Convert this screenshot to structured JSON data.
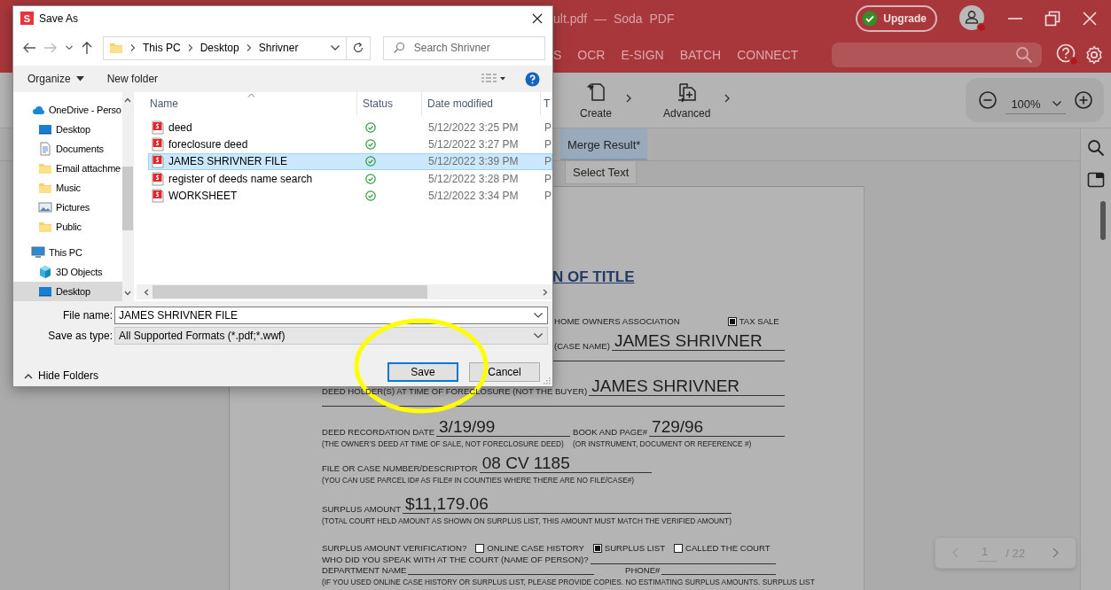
{
  "app": {
    "title": "ult.pdf — Soda PDF",
    "upgrade": "Upgrade",
    "nav": [
      {
        "label": "S"
      },
      {
        "label": "OCR"
      },
      {
        "label": "E-SIGN"
      },
      {
        "label": "BATCH"
      },
      {
        "label": "CONNECT"
      }
    ],
    "tools": [
      {
        "label": "Create",
        "kind": "create"
      },
      {
        "label": "Advanced",
        "kind": "advanced"
      }
    ],
    "zoom": "100%",
    "tabs": [
      {
        "label": "Merge Result*",
        "selected": true
      }
    ],
    "select_text": "Select Text",
    "page_nav": {
      "current": "1",
      "total": "/ 22"
    }
  },
  "document": {
    "rows": [
      {
        "kind": "title",
        "text": "N OF TITLE"
      },
      {
        "kind": "options",
        "options": [
          {
            "label": "HOME OWNERS ASSOCIATION"
          },
          {
            "label": "TAX SALE",
            "checked": true
          }
        ]
      },
      {
        "kind": "fields",
        "fields": [
          {
            "label": "(CASE NAME)",
            "value": "JAMES SHRIVNER"
          }
        ]
      },
      {
        "kind": "blank"
      },
      {
        "kind": "fields",
        "fields": [
          {
            "label": "DEED HOLDER(S) AT TIME OF FORECLOSURE (NOT THE BUYER)",
            "value": "JAMES SHRIVNER"
          }
        ]
      },
      {
        "kind": "blank"
      },
      {
        "kind": "fields",
        "fields": [
          {
            "label": "DEED RECORDATION DATE",
            "value": "3/19/99",
            "note": "(THE OWNER’S DEED AT TIME OF SALE, NOT FORECLOSURE DEED)"
          },
          {
            "label": "BOOK AND PAGE#",
            "value": "729/96",
            "note": "(OR INSTRUMENT, DOCUMENT OR REFERENCE #)"
          }
        ]
      },
      {
        "kind": "fields",
        "fields": [
          {
            "label": "FILE OR CASE NUMBER/DESCRIPTOR",
            "value": "08 CV 1185",
            "note": "(YOU CAN USE PARCEL ID# AS FILE# IN COUNTIES WHERE THERE ARE NO FILE/CASE#)"
          }
        ]
      },
      {
        "kind": "fields",
        "fields": [
          {
            "label": "SURPLUS AMOUNT",
            "value": "$11,179.06",
            "note": "(TOTAL COURT HELD AMOUNT AS SHOWN ON SURPLUS LIST, THIS AMOUNT MUST MATCH THE VERIFIED AMOUNT)"
          }
        ]
      },
      {
        "kind": "options",
        "lead": "SURPLUS AMOUNT VERIFICATION?",
        "options": [
          {
            "label": "ONLINE CASE HISTORY",
            "checked": false
          },
          {
            "label": "SURPLUS LIST",
            "checked": true
          },
          {
            "label": "CALLED THE COURT",
            "checked": false
          }
        ]
      },
      {
        "kind": "fields",
        "fields": [
          {
            "label": "WHO DID YOU SPEAK WITH AT THE COURT (NAME OF PERSON)?"
          }
        ]
      },
      {
        "kind": "fields",
        "fields": [
          {
            "label": "DEPARTMENT NAME"
          },
          {
            "label": "PHONE#"
          }
        ]
      },
      {
        "kind": "note",
        "text": "(IF YOU USED ONLINE CASE HISTORY OR SURPLUS LIST, PLEASE PROVIDE COPIES. NO ESTIMATING SURPLUS AMOUNTS. SURPLUS LIST"
      }
    ]
  },
  "dialog": {
    "logo_letter": "S",
    "title": "Save As",
    "path": [
      "This PC",
      "Desktop",
      "Shrivner"
    ],
    "search": {
      "placeholder": "Search Shrivner"
    },
    "commands": [
      "Organize",
      "New folder"
    ],
    "nav": [
      {
        "label": "OneDrive - Perso",
        "kind": "cloud",
        "selected": false,
        "children": [
          {
            "label": "Desktop",
            "kind": "desktop",
            "selected": false
          },
          {
            "label": "Documents",
            "kind": "documents",
            "selected": false
          },
          {
            "label": "Email attachme",
            "kind": "folder",
            "selected": false
          },
          {
            "label": "Music",
            "kind": "folder",
            "selected": false
          },
          {
            "label": "Pictures",
            "kind": "pictures",
            "selected": false
          },
          {
            "label": "Public",
            "kind": "folder",
            "selected": false
          }
        ]
      },
      {
        "label": "This PC",
        "kind": "computer",
        "selected": false,
        "children": [
          {
            "label": "3D Objects",
            "kind": "cube",
            "selected": false
          },
          {
            "label": "Desktop",
            "kind": "desktop",
            "selected": true
          }
        ]
      }
    ],
    "columns": [
      "Name",
      "Status",
      "Date modified",
      "T"
    ],
    "files": [
      {
        "name": "deed",
        "date": "5/12/2022 3:25 PM",
        "column_4": "P",
        "selected": false
      },
      {
        "name": "foreclosure deed",
        "date": "5/12/2022 3:27 PM",
        "column_4": "P",
        "selected": false
      },
      {
        "name": "JAMES SHRIVNER FILE",
        "date": "5/12/2022 3:39 PM",
        "column_4": "P",
        "selected": true
      },
      {
        "name": "register of deeds name search",
        "date": "5/12/2022 3:28 PM",
        "column_4": "P",
        "selected": false
      },
      {
        "name": "WORKSHEET",
        "date": "5/12/2022 3:34 PM",
        "column_4": "P",
        "selected": false
      }
    ],
    "file_name": {
      "label": "File name:",
      "value": "JAMES SHRIVNER FILE"
    },
    "save_type": {
      "label": "Save as type:",
      "value": "All Supported Formats (*.pdf;*.wwf)"
    },
    "hide_folders": "Hide Folders",
    "buttons": [
      {
        "label": "Save",
        "kind": "default"
      },
      {
        "label": "Cancel",
        "kind": "normal"
      }
    ]
  }
}
